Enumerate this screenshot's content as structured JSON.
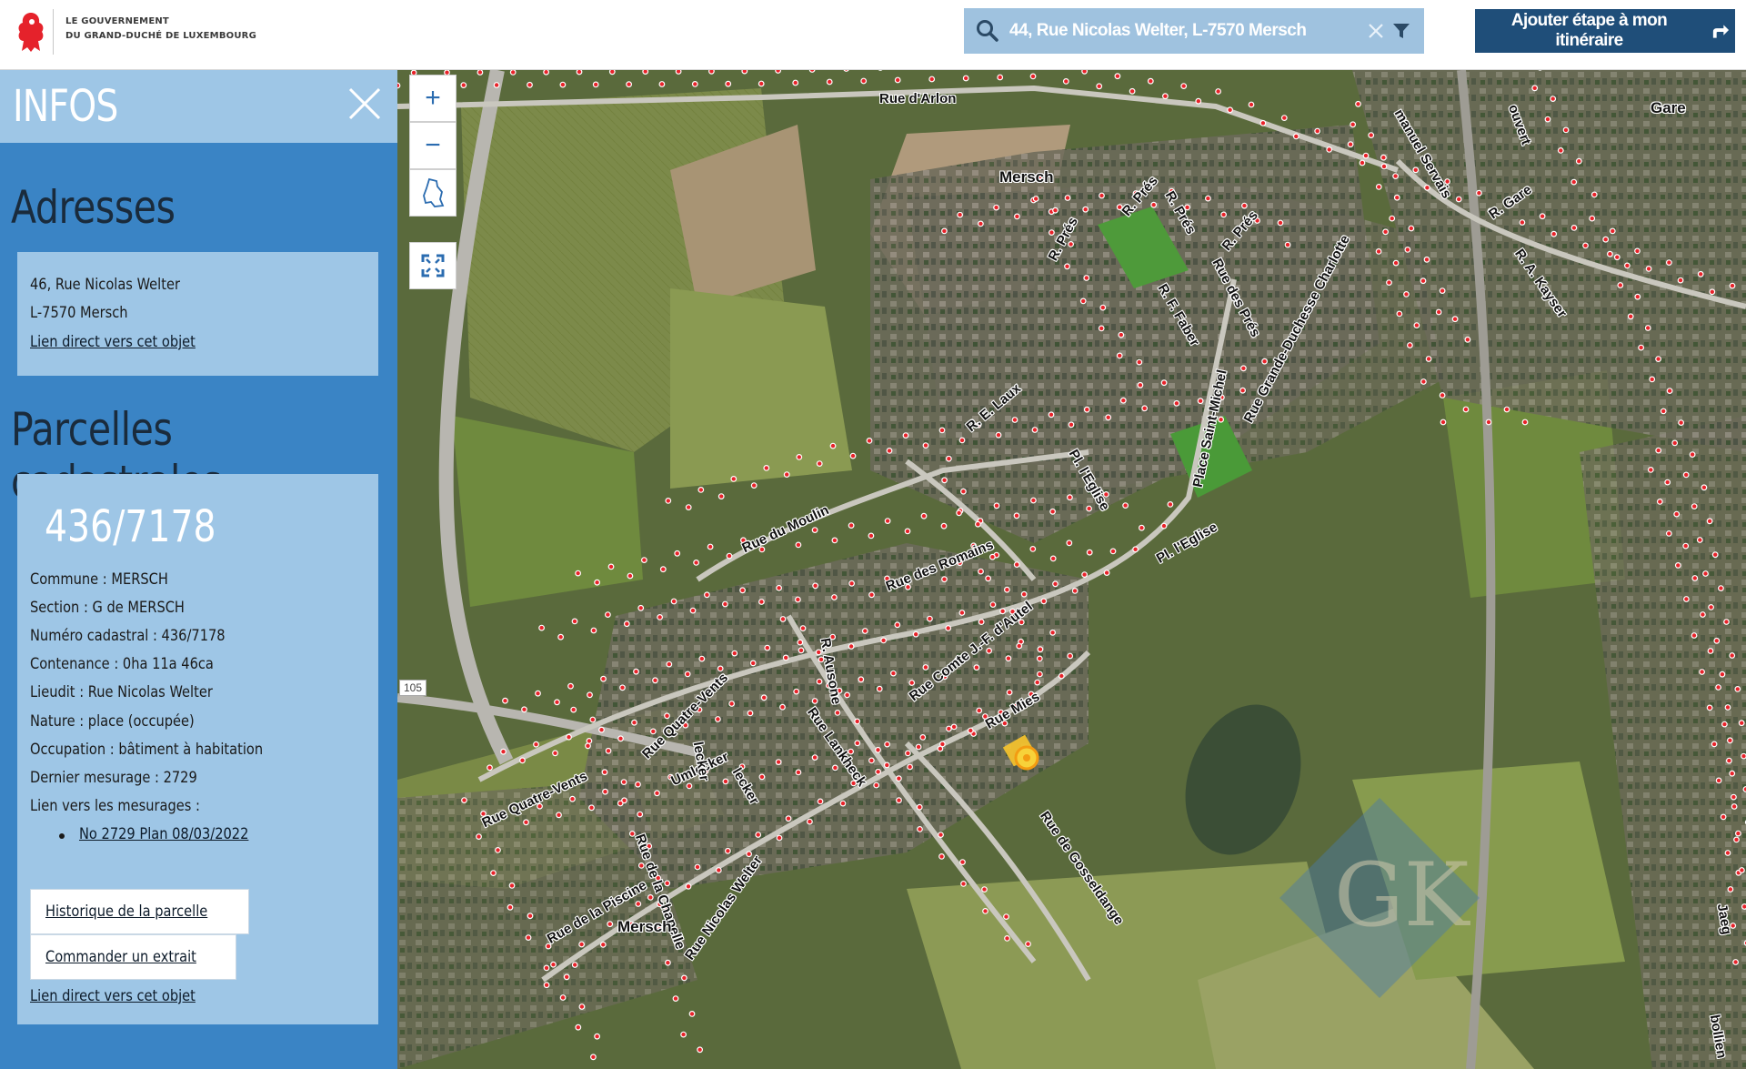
{
  "header": {
    "logo_text_line1": "LE GOUVERNEMENT",
    "logo_text_line2": "DU GRAND-DUCHÉ DE LUXEMBOURG",
    "search_value": "44, Rue Nicolas Welter, L-7570 Mersch",
    "itinerary_button": "Ajouter étape à mon itinéraire"
  },
  "sidebar": {
    "title": "INFOS",
    "addresses_heading": "Adresses",
    "address": {
      "line1": "46, Rue Nicolas Welter",
      "line2": "L-7570 Mersch",
      "link": "Lien direct vers cet objet"
    },
    "parcels_heading": "Parcelles cadastrales",
    "parcel": {
      "number": "436/7178",
      "commune": "Commune : MERSCH",
      "section": "Section : G de MERSCH",
      "numero": "Numéro cadastral : 436/7178",
      "contenance": "Contenance : 0ha 11a 46ca",
      "lieudit": "Lieudit : Rue Nicolas Welter",
      "nature": "Nature : place (occupée)",
      "occupation": "Occupation : bâtiment à habitation",
      "dernier": "Dernier mesurage : 2729",
      "mesurages_label": "Lien vers les mesurages :",
      "mesurage_link": "No 2729 Plan 08/03/2022",
      "history_button": "Historique de la parcelle",
      "extract_button": "Commander un extrait",
      "link": "Lien direct vers cet objet"
    }
  },
  "map": {
    "zoom_in": "+",
    "zoom_out": "−",
    "route_number": "105",
    "labels": {
      "rue_arlon": "Rue d'Arlon",
      "mersch_north": "Mersch",
      "gare": "Gare",
      "r_pres1": "R. Prés",
      "r_pres2": "R. Prés",
      "r_pres3": "R. Prés",
      "r_pres4": "R. Prés",
      "r_f_faber": "R. F. Faber",
      "rue_des_pres": "Rue des Prés",
      "rue_gd_charlotte": "Rue Grande-Duchesse Charlotte",
      "r_gare": "R. Gare",
      "r_a_kayser": "R. A. Kayser",
      "rue_emmanuel_servais": "manuel Servais",
      "place_st_michel": "Place Saint-Michel",
      "r_e_laux": "R. E. Laux",
      "pl_eglise1": "Pl. l'Eglise",
      "pl_eglise2": "Pl. l'Eglise",
      "rue_du_moulin": "Rue du Moulin",
      "rue_des_romains": "Rue des Romains",
      "r_ausone": "R. Ausone",
      "rue_comte": "Rue Comte J.-F. d'Autel",
      "rue_quatre_vents1": "Rue Quatre-Vents",
      "rue_quatre_vents2": "Rue Quatre-Vents",
      "rue_mies": "Rue Mies",
      "rue_lankheck": "Rue Lankheck",
      "umlecker": "Umlecker",
      "jecker1": "lecker",
      "jecker2": "lecker",
      "rue_de_la_chapelle": "Rue de la Chapelle",
      "rue_nicolas_welter": "Rue Nicolas Welter",
      "rue_de_la_piscine": "Rue de la Piscine",
      "mersch_south": "Mersch",
      "rue_gosseldange": "Rue de Gosseldange",
      "jaeg": "Jaeg",
      "ouvert": "ouvert",
      "bollien": "bollien"
    },
    "watermark": "GK"
  },
  "colors": {
    "sidebar_bg": "#3a84c5",
    "sidebar_card": "#9ec6e6",
    "search_bg": "#9fc2df",
    "itinerary_bg": "#1f4e79",
    "address_dot": "#e8232a"
  }
}
